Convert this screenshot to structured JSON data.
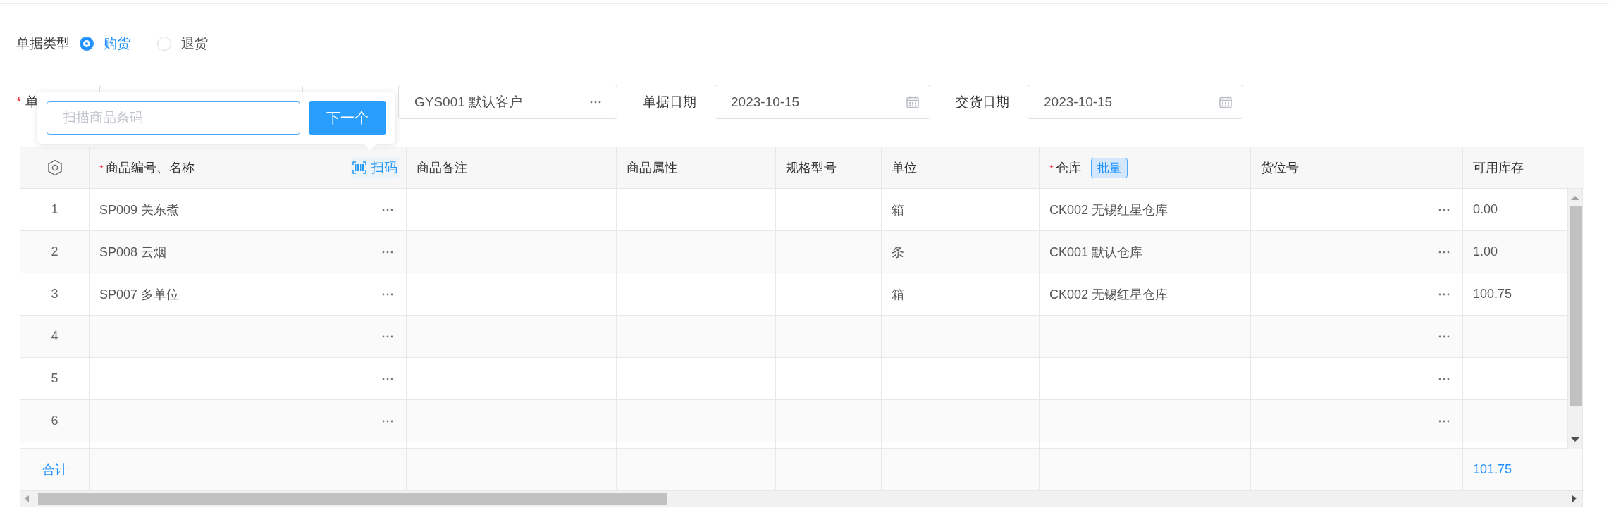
{
  "doc_type": {
    "label": "单据类型",
    "options": [
      {
        "label": "购货",
        "selected": true
      },
      {
        "label": "退货",
        "selected": false
      }
    ]
  },
  "form": {
    "partial_label": {
      "mark": "*",
      "text": "单"
    },
    "supplier": {
      "value": "GYS001 默认客户"
    },
    "dates": [
      {
        "label": "单据日期",
        "value": "2023-10-15"
      },
      {
        "label": "交货日期",
        "value": "2023-10-15"
      }
    ]
  },
  "scan_popup": {
    "placeholder": "扫描商品条码",
    "button": "下一个"
  },
  "table": {
    "columns": [
      {
        "kind": "settings"
      },
      {
        "kind": "text",
        "label": "商品编号、名称",
        "mark": "*",
        "action": "扫码"
      },
      {
        "kind": "text",
        "label": "商品备注"
      },
      {
        "kind": "text",
        "label": "商品属性"
      },
      {
        "kind": "text",
        "label": "规格型号"
      },
      {
        "kind": "text",
        "label": "单位"
      },
      {
        "kind": "text",
        "label": "仓库",
        "mark": "*",
        "tag": "批量"
      },
      {
        "kind": "text",
        "label": "货位号"
      },
      {
        "kind": "text",
        "label": "可用库存"
      }
    ],
    "rows": [
      {
        "index": "1",
        "product": "SP009 关东煮",
        "unit": "箱",
        "warehouse": "CK002 无锡红星仓库",
        "stock": "0.00"
      },
      {
        "index": "2",
        "product": "SP008 云烟",
        "unit": "条",
        "warehouse": "CK001 默认仓库",
        "stock": "1.00"
      },
      {
        "index": "3",
        "product": "SP007 多单位",
        "unit": "箱",
        "warehouse": "CK002 无锡红星仓库",
        "stock": "100.75"
      },
      {
        "index": "4"
      },
      {
        "index": "5"
      },
      {
        "index": "6"
      }
    ],
    "footer": {
      "label": "合计",
      "stock_total": "101.75"
    }
  }
}
